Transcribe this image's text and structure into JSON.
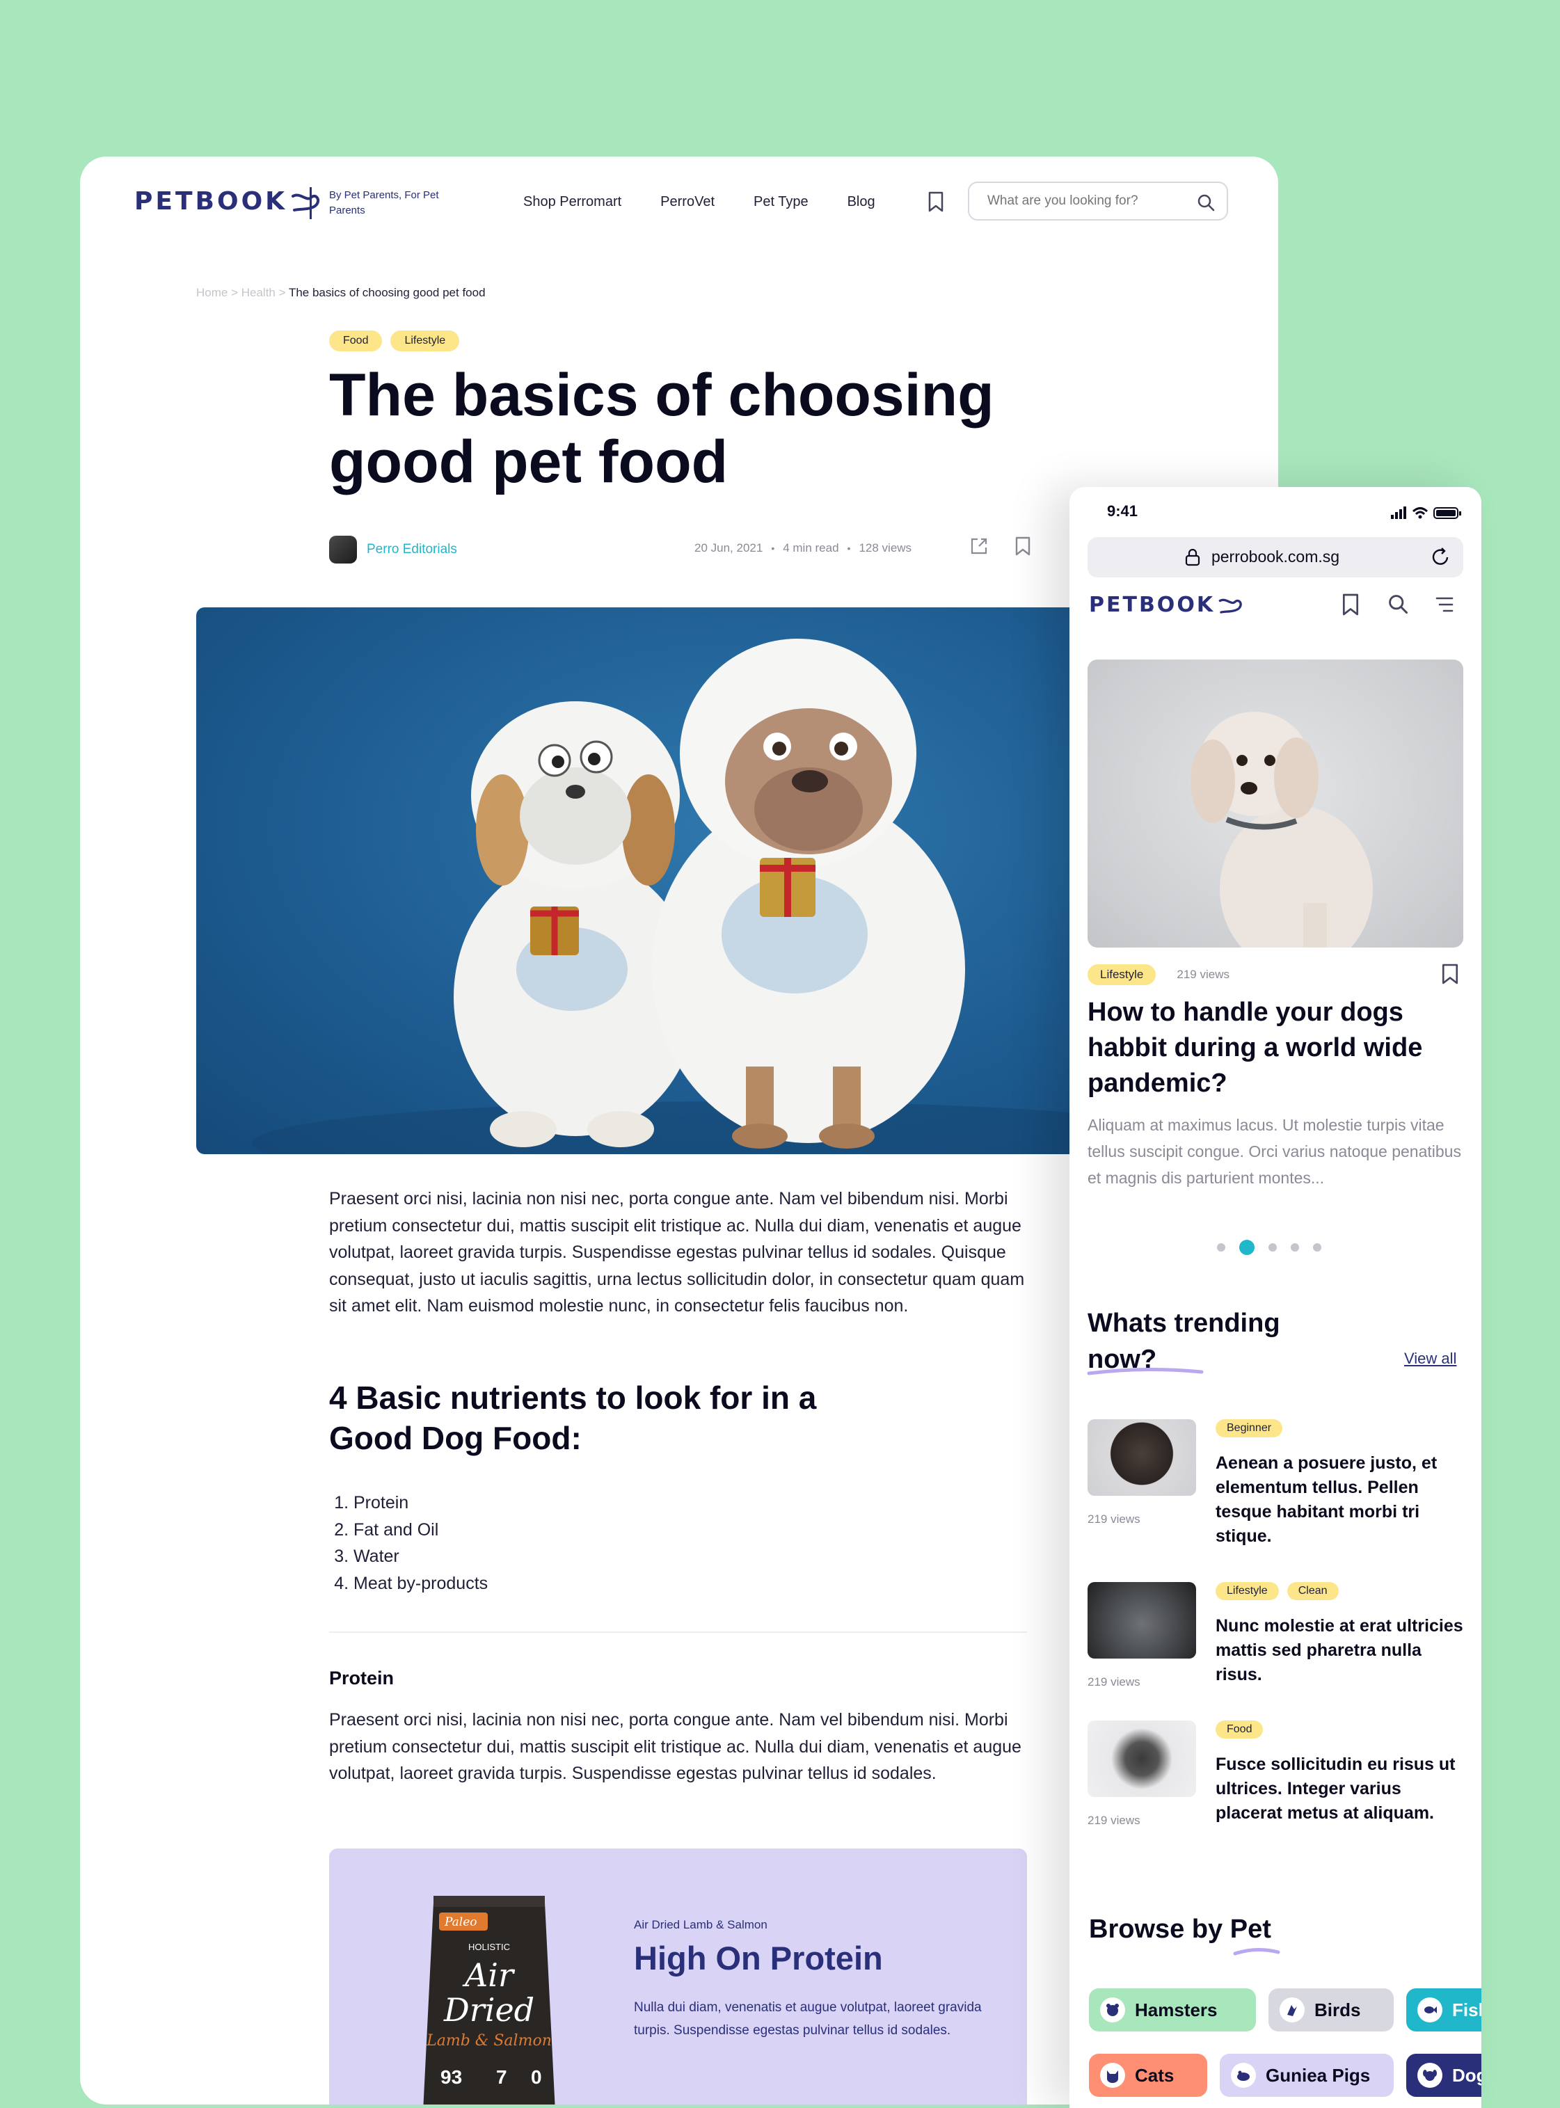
{
  "desktop": {
    "logo": "PETBOOK",
    "tagline": "By Pet Parents, For Pet Parents",
    "nav": [
      "Shop Perromart",
      "PerroVet",
      "Pet Type",
      "Blog"
    ],
    "search": {
      "placeholder": "What are you looking for?"
    },
    "breadcrumb": {
      "home": "Home",
      "section": "Health",
      "current": "The basics of choosing good pet food"
    },
    "tags": [
      "Food",
      "Lifestyle"
    ],
    "title": "The basics of choosing good pet food",
    "author": "Perro Editorials",
    "meta": {
      "date": "20 Jun, 2021",
      "read": "4 min read",
      "views": "128 views"
    },
    "paragraph1": "Praesent orci nisi, lacinia non nisi nec, porta congue ante. Nam vel bibendum nisi. Morbi pretium consectetur dui, mattis suscipit elit tristique ac. Nulla dui diam, venenatis et augue volutpat, laoreet gravida turpis. Suspendisse egestas pulvinar tellus id sodales. Quisque consequat, justo ut iaculis sagittis, urna lectus sollicitudin dolor, in consectetur quam quam sit amet elit. Nam euismod molestie nunc, in consectetur felis faucibus non.",
    "heading2": "4 Basic nutrients to look for in a Good Dog Food:",
    "nutrients": [
      "Protein",
      "Fat and Oil",
      "Water",
      "Meat by-products"
    ],
    "heading3": "Protein",
    "paragraph2": "Praesent orci nisi, lacinia non nisi nec, porta congue ante. Nam vel bibendum nisi. Morbi pretium consectetur dui, mattis suscipit elit tristique ac. Nulla dui diam, venenatis et augue volutpat, laoreet gravida turpis. Suspendisse egestas pulvinar tellus id sodales.",
    "promo": {
      "kicker": "Air Dried Lamb & Salmon",
      "title": "High On Protein",
      "desc": "Nulla dui diam, venenatis et augue volutpat, laoreet gravida turpis. Suspendisse egestas pulvinar tellus id sodales.",
      "bag": {
        "brand": "Paleo",
        "line": "HOLISTIC",
        "name1": "Air",
        "name2": "Dried",
        "flavor": "Lamb & Salmon",
        "stat1": "93",
        "stat2": "7",
        "stat3": "0"
      }
    }
  },
  "mobile": {
    "time": "9:41",
    "url": "perrobook.com.sg",
    "logo": "PETBOOK",
    "featured": {
      "tag": "Lifestyle",
      "views": "219 views",
      "title": "How to handle your dogs habbit during a world wide pandemic?",
      "excerpt": "Aliquam at maximus lacus. Ut molestie turpis vitae tellus suscipit congue. Orci varius natoque penatibus et magnis dis parturient montes..."
    },
    "trending_title": "Whats trending now?",
    "view_all": "View all",
    "trending": [
      {
        "tags": [
          "Beginner"
        ],
        "title": "Aenean a posuere justo, et elementum tellus. Pellen tesque habitant morbi tri stique.",
        "views": "219 views"
      },
      {
        "tags": [
          "Lifestyle",
          "Clean"
        ],
        "title": "Nunc molestie at erat ultricies mattis sed pharetra nulla risus.",
        "views": "219 views"
      },
      {
        "tags": [
          "Food"
        ],
        "title": "Fusce sollicitudin eu risus ut ultrices. Integer varius placerat metus at aliquam.",
        "views": "219 views"
      }
    ],
    "browse_title": "Browse by Pet",
    "pets": [
      {
        "label": "Hamsters",
        "color": "#a8e6bc"
      },
      {
        "label": "Birds",
        "color": "#d8d8e0"
      },
      {
        "label": "Fish",
        "color": "#1fb7c9"
      },
      {
        "label": "Cats",
        "color": "#ff8f73"
      },
      {
        "label": "Guniea Pigs",
        "color": "#d9d3f5"
      },
      {
        "label": "Dogs",
        "color": "#2a2f7a"
      }
    ]
  }
}
